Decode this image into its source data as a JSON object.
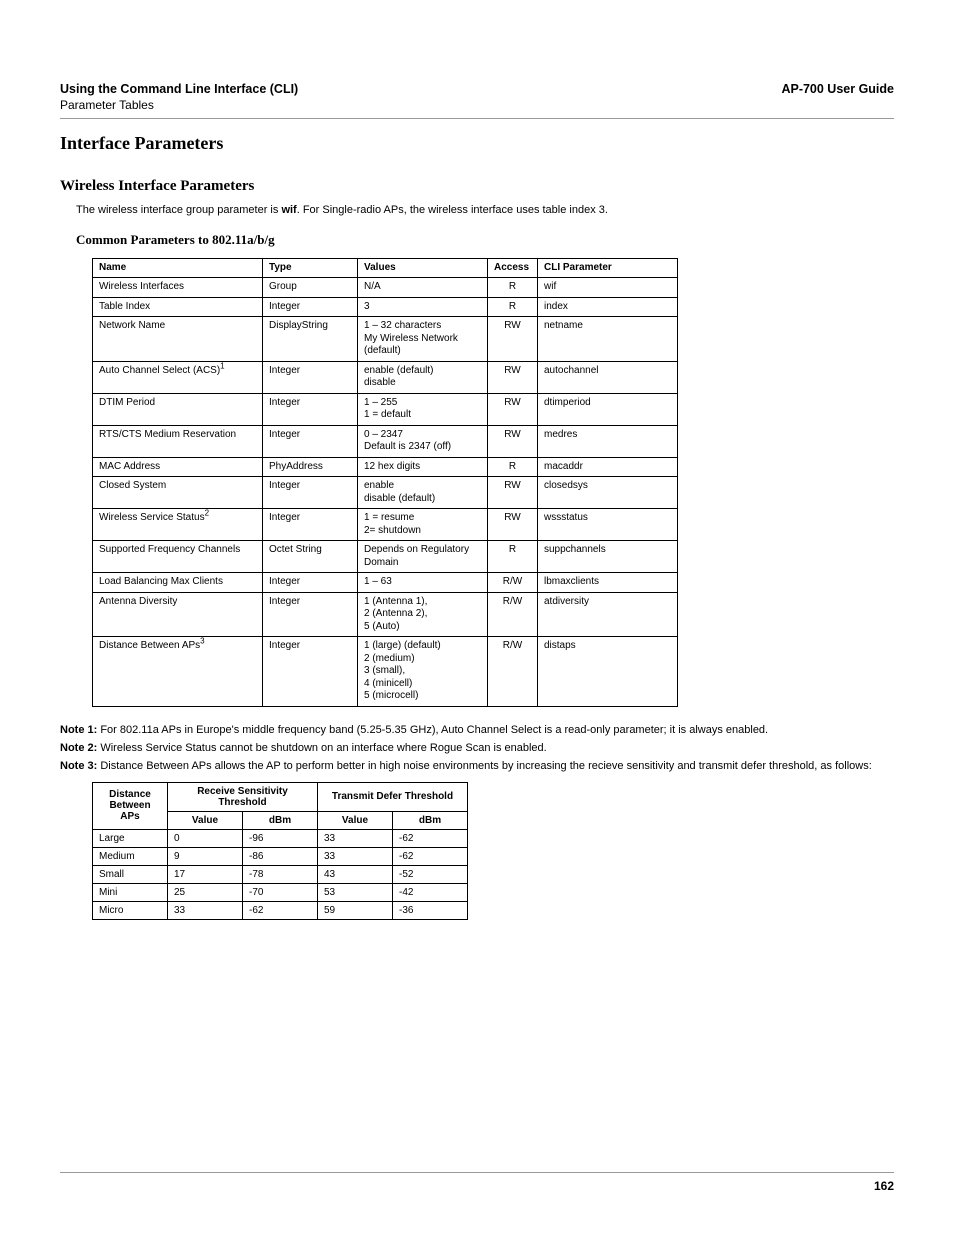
{
  "header": {
    "title_left": "Using the Command Line Interface (CLI)",
    "title_right": "AP-700 User Guide",
    "subtitle": "Parameter Tables"
  },
  "section_h1": "Interface Parameters",
  "section_h2": "Wireless Interface Parameters",
  "intro_pre": "The wireless interface group parameter is ",
  "intro_bold": "wif",
  "intro_post": ". For Single-radio APs, the wireless interface uses table index 3.",
  "section_h3": "Common Parameters to 802.11a/b/g",
  "table1": {
    "headers": [
      "Name",
      "Type",
      "Values",
      "Access",
      "CLI Parameter"
    ],
    "rows": [
      {
        "name": "Wireless Interfaces",
        "sup": "",
        "type": "Group",
        "values": "N/A",
        "access": "R",
        "cli": "wif"
      },
      {
        "name": "Table Index",
        "sup": "",
        "type": "Integer",
        "values": "3",
        "access": "R",
        "cli": "index"
      },
      {
        "name": "Network Name",
        "sup": "",
        "type": "DisplayString",
        "values": "1 – 32 characters\nMy Wireless Network (default)",
        "access": "RW",
        "cli": "netname"
      },
      {
        "name": "Auto Channel Select (ACS)",
        "sup": "1",
        "type": "Integer",
        "values": "enable (default)\ndisable",
        "access": "RW",
        "cli": "autochannel"
      },
      {
        "name": "DTIM Period",
        "sup": "",
        "type": "Integer",
        "values": "1 – 255\n1 = default",
        "access": "RW",
        "cli": "dtimperiod"
      },
      {
        "name": "RTS/CTS Medium Reservation",
        "sup": "",
        "type": "Integer",
        "values": "0 – 2347\nDefault is 2347 (off)",
        "access": "RW",
        "cli": "medres"
      },
      {
        "name": "MAC Address",
        "sup": "",
        "type": "PhyAddress",
        "values": "12 hex digits",
        "access": "R",
        "cli": "macaddr"
      },
      {
        "name": "Closed System",
        "sup": "",
        "type": "Integer",
        "values": "enable\ndisable (default)",
        "access": "RW",
        "cli": "closedsys"
      },
      {
        "name": "Wireless Service Status",
        "sup": "2",
        "type": "Integer",
        "values": "1 = resume\n2= shutdown",
        "access": "RW",
        "cli": "wssstatus"
      },
      {
        "name": "Supported Frequency Channels",
        "sup": "",
        "type": "Octet String",
        "values": "Depends on Regulatory Domain",
        "access": "R",
        "cli": "suppchannels"
      },
      {
        "name": "Load Balancing Max Clients",
        "sup": "",
        "type": "Integer",
        "values": "1 – 63",
        "access": "R/W",
        "cli": "lbmaxclients"
      },
      {
        "name": "Antenna Diversity",
        "sup": "",
        "type": "Integer",
        "values": "1 (Antenna 1),\n2 (Antenna 2),\n5 (Auto)",
        "access": "R/W",
        "cli": "atdiversity"
      },
      {
        "name": "Distance Between APs",
        "sup": "3",
        "type": "Integer",
        "values": "1 (large) (default)\n2 (medium)\n3 (small),\n4 (minicell)\n5 (microcell)",
        "access": "R/W",
        "cli": "distaps"
      }
    ]
  },
  "notes": {
    "n1_label": "Note 1:",
    "n1_text": " For 802.11a APs in Europe's middle frequency band (5.25-5.35 GHz), Auto Channel Select is a read-only parameter; it is always enabled.",
    "n2_label": "Note 2:",
    "n2_text": " Wireless Service Status cannot be shutdown on an interface where Rogue Scan is enabled.",
    "n3_label": "Note 3:",
    "n3_text": " Distance Between APs allows the AP to perform better in high noise environments by increasing the recieve sensitivity and transmit defer threshold, as follows:"
  },
  "table2": {
    "h_dist": "Distance Between APs",
    "h_recv": "Receive Sensitivity Threshold",
    "h_trans": "Transmit Defer Threshold",
    "sub_value": "Value",
    "sub_dbm": "dBm",
    "rows": [
      {
        "d": "Large",
        "rv": "0",
        "rdbm": "-96",
        "tv": "33",
        "tdbm": "-62"
      },
      {
        "d": "Medium",
        "rv": "9",
        "rdbm": "-86",
        "tv": "33",
        "tdbm": "-62"
      },
      {
        "d": "Small",
        "rv": "17",
        "rdbm": "-78",
        "tv": "43",
        "tdbm": "-52"
      },
      {
        "d": "Mini",
        "rv": "25",
        "rdbm": "-70",
        "tv": "53",
        "tdbm": "-42"
      },
      {
        "d": "Micro",
        "rv": "33",
        "rdbm": "-62",
        "tv": "59",
        "tdbm": "-36"
      }
    ]
  },
  "page_number": "162"
}
